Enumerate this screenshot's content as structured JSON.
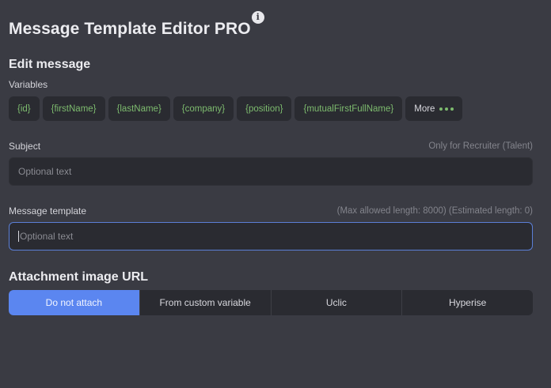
{
  "app": {
    "title": "Message Template Editor PRO",
    "info_icon": "i"
  },
  "edit": {
    "title": "Edit message",
    "variables_label": "Variables",
    "variables": [
      "{id}",
      "{firstName}",
      "{lastName}",
      "{company}",
      "{position}",
      "{mutualFirstFullName}"
    ],
    "more_label": "More"
  },
  "subject": {
    "label": "Subject",
    "hint": "Only for Recruiter (Talent)",
    "placeholder": "Optional text",
    "value": ""
  },
  "message": {
    "label": "Message template",
    "hint": "(Max allowed length: 8000) (Estimated length: 0)",
    "placeholder": "Optional text",
    "value": ""
  },
  "attachment": {
    "title": "Attachment image URL",
    "options": [
      "Do not attach",
      "From custom variable",
      "Uclic",
      "Hyperise"
    ],
    "selected": "Do not attach"
  },
  "colors": {
    "background": "#3a3b43",
    "panel": "#2a2b31",
    "accent": "#5b86f0",
    "variable_text": "#7dbb6e"
  }
}
